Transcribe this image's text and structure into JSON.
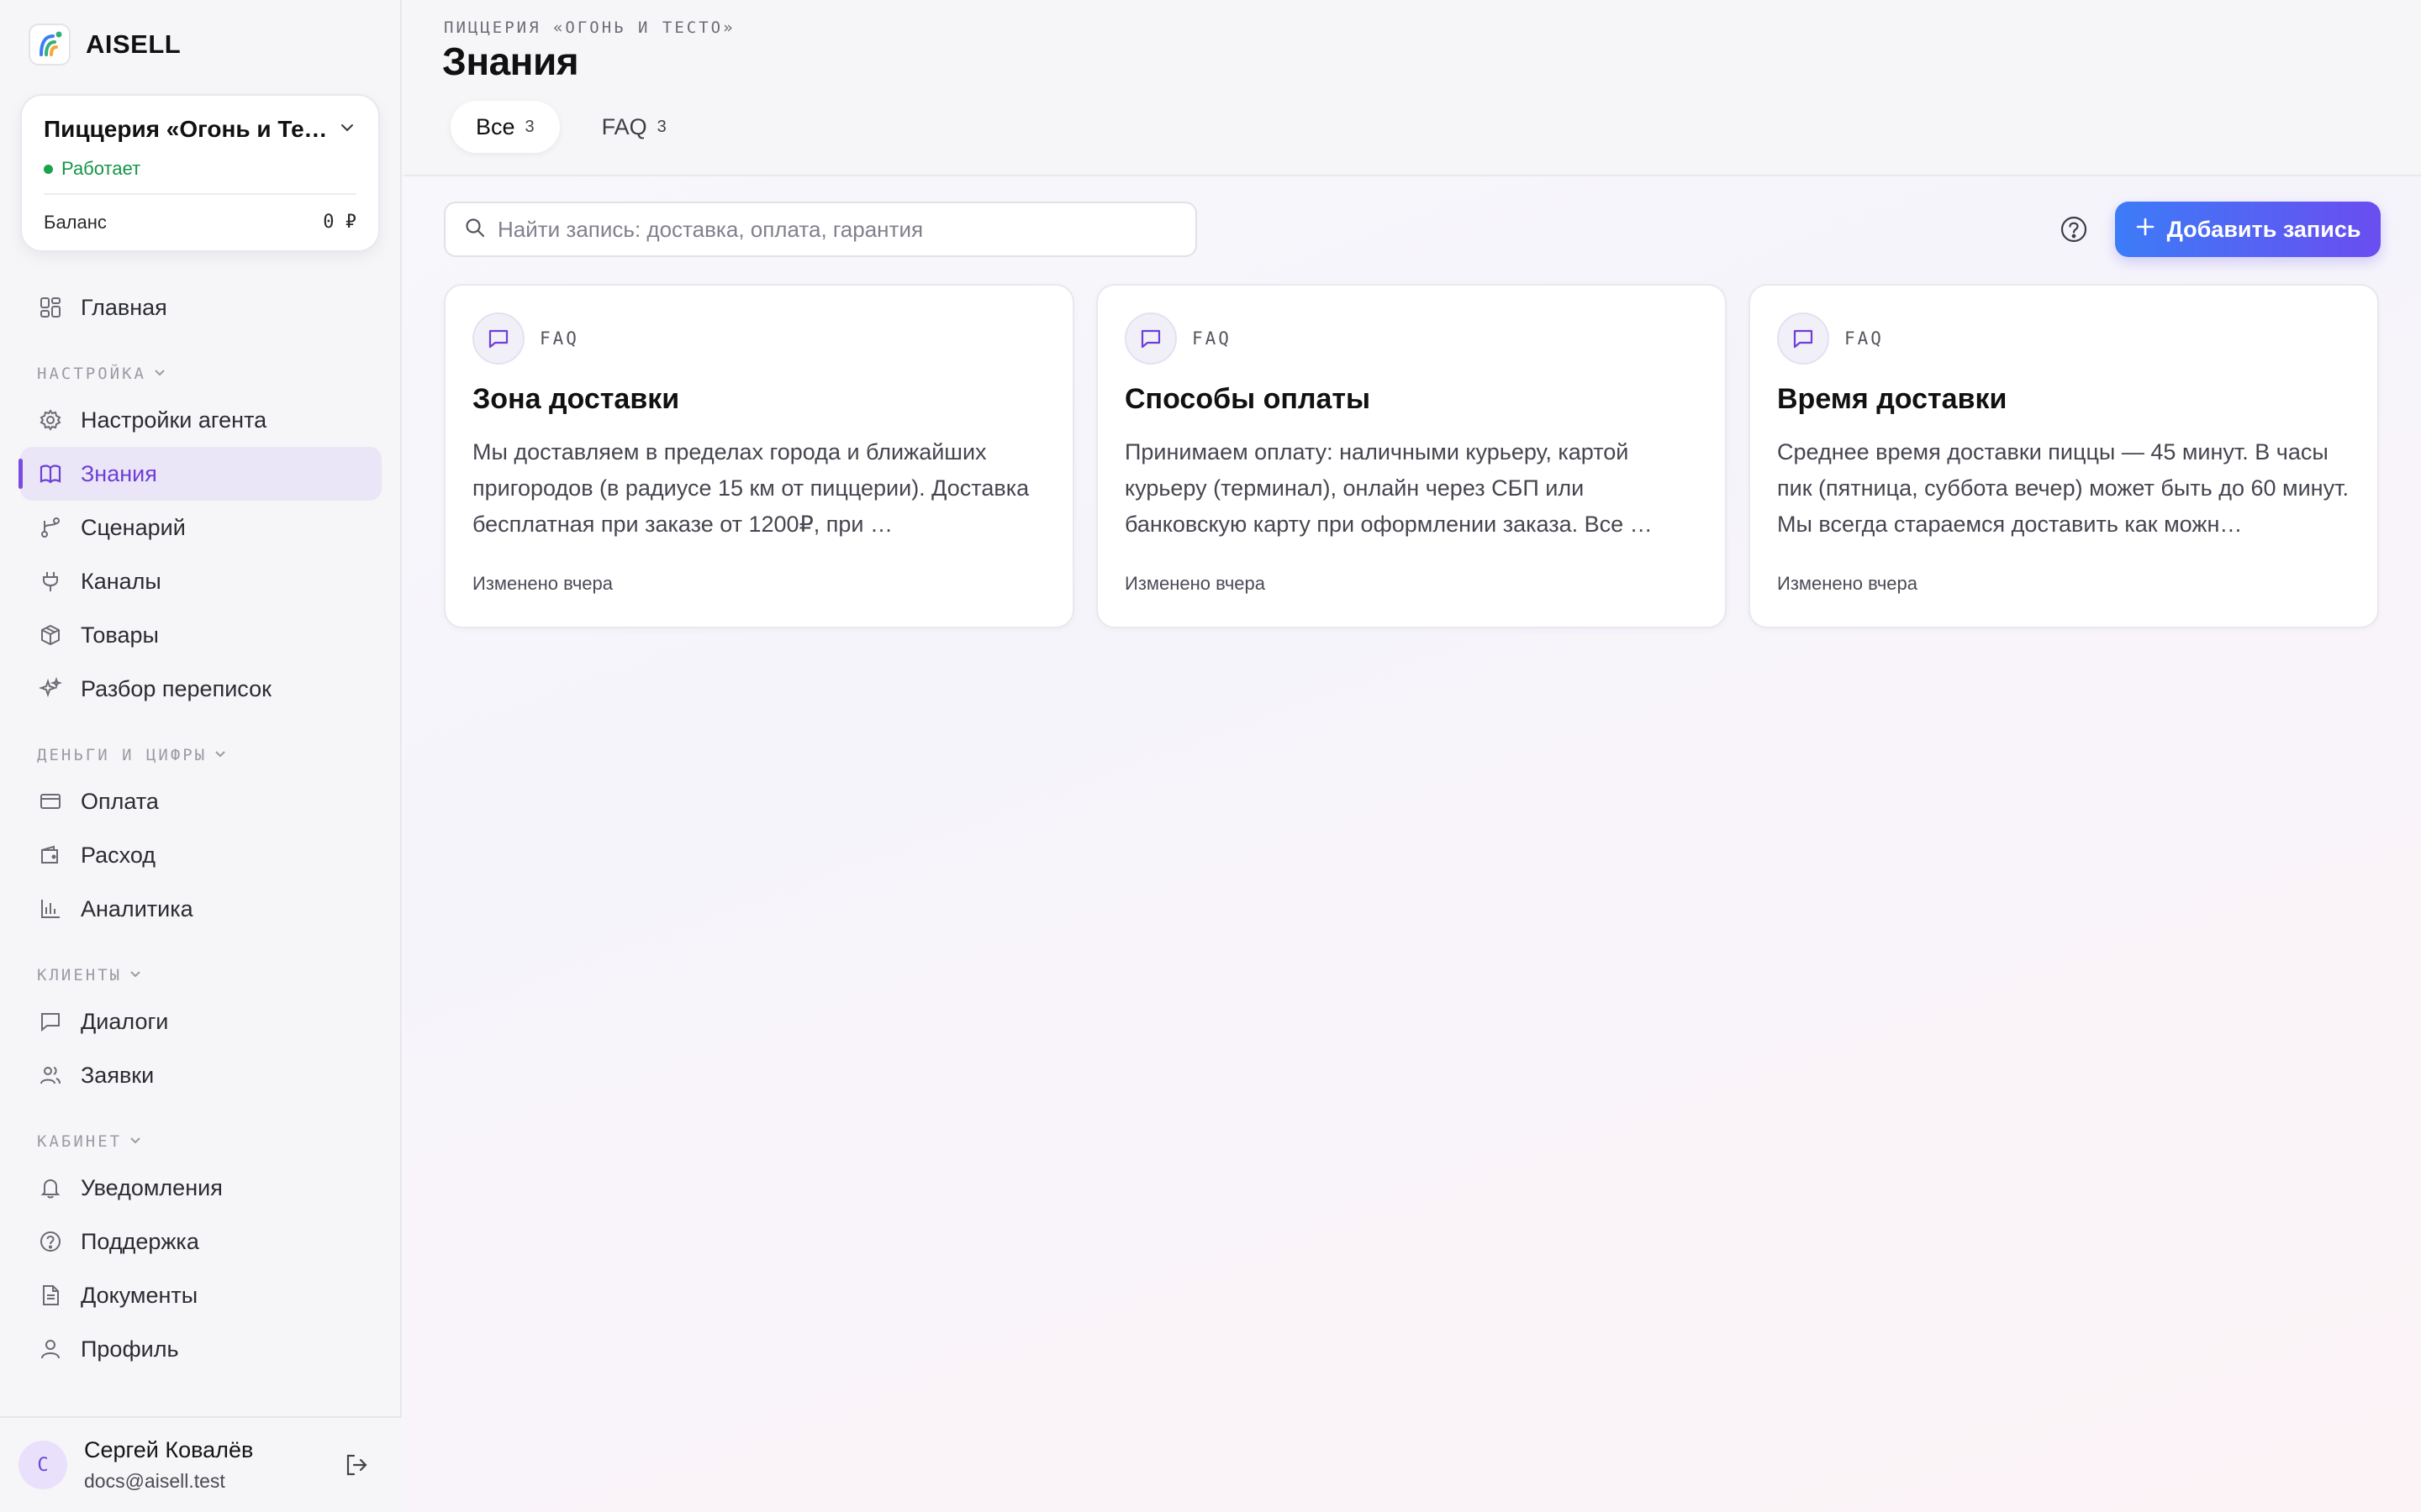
{
  "brand": {
    "name": "AISELL"
  },
  "workspace": {
    "name": "Пиццерия «Огонь и Тест…",
    "status": "Работает",
    "balance_label": "Баланс",
    "balance_value": "0 ₽"
  },
  "nav": {
    "home": "Главная",
    "section_settings": "НАСТРОЙКА",
    "agent_settings": "Настройки агента",
    "knowledge": "Знания",
    "scenario": "Сценарий",
    "channels": "Каналы",
    "products": "Товары",
    "chat_review": "Разбор переписок",
    "section_money": "ДЕНЬГИ И ЦИФРЫ",
    "payment": "Оплата",
    "expense": "Расход",
    "analytics": "Аналитика",
    "section_clients": "КЛИЕНТЫ",
    "dialogs": "Диалоги",
    "requests": "Заявки",
    "section_cabinet": "КАБИНЕТ",
    "notifications": "Уведомления",
    "support": "Поддержка",
    "documents": "Документы",
    "profile": "Профиль"
  },
  "user": {
    "initial": "С",
    "name": "Сергей Ковалёв",
    "email": "docs@aisell.test"
  },
  "header": {
    "eyebrow": "ПИЦЦЕРИЯ «ОГОНЬ И ТЕСТО»",
    "title": "Знания",
    "tabs": [
      {
        "label": "Все",
        "count": "3",
        "active": true
      },
      {
        "label": "FAQ",
        "count": "3",
        "active": false
      }
    ]
  },
  "toolbar": {
    "search_placeholder": "Найти запись: доставка, оплата, гарантия",
    "add_label": "Добавить запись"
  },
  "cards": [
    {
      "tag": "FAQ",
      "title": "Зона доставки",
      "body": "Мы доставляем в пределах города и ближайших пригородов (в радиусе 15 км от пиццерии). Доставка бесплатная при заказе от 1200₽, при …",
      "meta": "Изменено вчера"
    },
    {
      "tag": "FAQ",
      "title": "Способы оплаты",
      "body": "Принимаем оплату: наличными курьеру, картой курьеру (терминал), онлайн через СБП или банковскую карту при оформлении заказа. Все …",
      "meta": "Изменено вчера"
    },
    {
      "tag": "FAQ",
      "title": "Время доставки",
      "body": "Среднее время доставки пиццы — 45 минут. В часы пик (пятница, суббота вечер) может быть до 60 минут. Мы всегда стараемся доставить как можн…",
      "meta": "Изменено вчера"
    }
  ],
  "colors": {
    "accent": "#7b4be0",
    "status_green": "#1aa34a",
    "button_gradient_start": "#3c7cf7",
    "button_gradient_end": "#6a4df0"
  }
}
